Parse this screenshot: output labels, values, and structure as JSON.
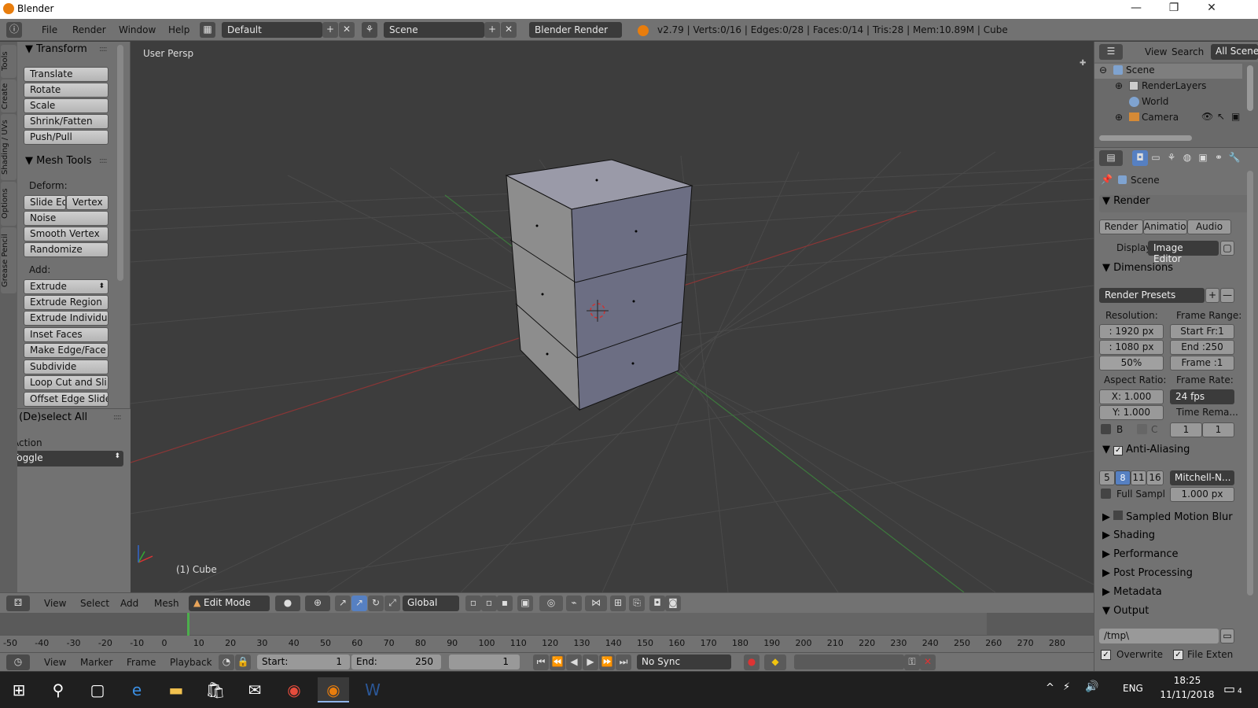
{
  "window": {
    "title": "Blender",
    "minimize": "—",
    "restore": "❐",
    "close": "✕"
  },
  "menubar": {
    "file": "File",
    "render": "Render",
    "window": "Window",
    "help": "Help",
    "layout": "Default",
    "scene": "Scene",
    "engine": "Blender Render",
    "stats": "v2.79 | Verts:0/16 | Edges:0/28 | Faces:0/14 | Tris:28 | Mem:10.89M | Cube"
  },
  "tool_tabs": [
    "Tools",
    "Create",
    "Shading / UVs",
    "Options",
    "Grease Pencil"
  ],
  "transform": {
    "title": "Transform",
    "buttons": [
      "Translate",
      "Rotate",
      "Scale",
      "Shrink/Fatten",
      "Push/Pull"
    ]
  },
  "mesh_tools": {
    "title": "Mesh Tools",
    "deform_label": "Deform:",
    "slide_edge": "Slide Ed",
    "vertex": "Vertex",
    "deform_buttons": [
      "Noise",
      "Smooth Vertex",
      "Randomize"
    ],
    "add_label": "Add:",
    "extrude": "Extrude",
    "add_buttons": [
      "Extrude Region",
      "Extrude Individual",
      "Inset Faces",
      "Make Edge/Face",
      "Subdivide",
      "Loop Cut and Sli...",
      "Offset Edge Slide"
    ]
  },
  "operator": {
    "title": "(De)select All",
    "action_label": "Action",
    "action_value": "Toggle"
  },
  "viewport": {
    "view_name": "User Persp",
    "object_label": "(1) Cube"
  },
  "outliner": {
    "view": "View",
    "search": "Search",
    "filter": "All Scenes",
    "items": [
      "Scene",
      "RenderLayers",
      "World",
      "Camera"
    ]
  },
  "properties": {
    "context": "Scene",
    "render": {
      "title": "Render",
      "render_btn": "Render",
      "anim_btn": "Animation",
      "audio_btn": "Audio",
      "display_label": "Display:",
      "display_value": "Image Editor"
    },
    "dimensions": {
      "title": "Dimensions",
      "presets": "Render Presets",
      "resolution_label": "Resolution:",
      "res_x": ": 1920 px",
      "res_y": ": 1080 px",
      "res_pct": "50%",
      "frame_range_label": "Frame Range:",
      "start": "Start Fr:1",
      "end": "End :250",
      "frame": "Frame :1",
      "aspect_label": "Aspect Ratio:",
      "aspect_x": "X:  1.000",
      "aspect_y": "Y:  1.000",
      "framerate_label": "Frame Rate:",
      "fps": "24 fps",
      "time_remap_label": "Time Rema...",
      "border": "B",
      "crop": "C",
      "remap_old": "1",
      "remap_new": "1"
    },
    "aa": {
      "title": "Anti-Aliasing",
      "samples": [
        "5",
        "8",
        "11",
        "16"
      ],
      "filter": "Mitchell-N...",
      "full_sample": "Full Sampl",
      "filter_size": "1.000 px"
    },
    "collapsed": [
      "Sampled Motion Blur",
      "Shading",
      "Performance",
      "Post Processing",
      "Metadata"
    ],
    "output": {
      "title": "Output",
      "path": "/tmp\\",
      "overwrite": "Overwrite",
      "file_ext": "File Exten"
    }
  },
  "viewport_header": {
    "view": "View",
    "select": "Select",
    "add": "Add",
    "mesh": "Mesh",
    "mode": "Edit Mode",
    "orientation": "Global"
  },
  "timeline": {
    "ticks": [
      "-50",
      "-40",
      "-30",
      "-20",
      "-10",
      "0",
      "10",
      "20",
      "30",
      "40",
      "50",
      "60",
      "70",
      "80",
      "90",
      "100",
      "110",
      "120",
      "130",
      "140",
      "150",
      "160",
      "170",
      "180",
      "190",
      "200",
      "210",
      "220",
      "230",
      "240",
      "250",
      "260",
      "270",
      "280"
    ],
    "current_frame_mark": 0
  },
  "timeline_header": {
    "view": "View",
    "marker": "Marker",
    "frame": "Frame",
    "playback": "Playback",
    "start_label": "Start:",
    "start_value": "1",
    "end_label": "End:",
    "end_value": "250",
    "current": "1",
    "sync": "No Sync"
  },
  "taskbar": {
    "lang": "ENG",
    "time": "18:25",
    "date": "11/11/2018",
    "notif_count": "4"
  },
  "colors": {
    "accent_blue": "#5680c2",
    "viewport_bg": "#3d3d3d",
    "panel": "#727272"
  }
}
